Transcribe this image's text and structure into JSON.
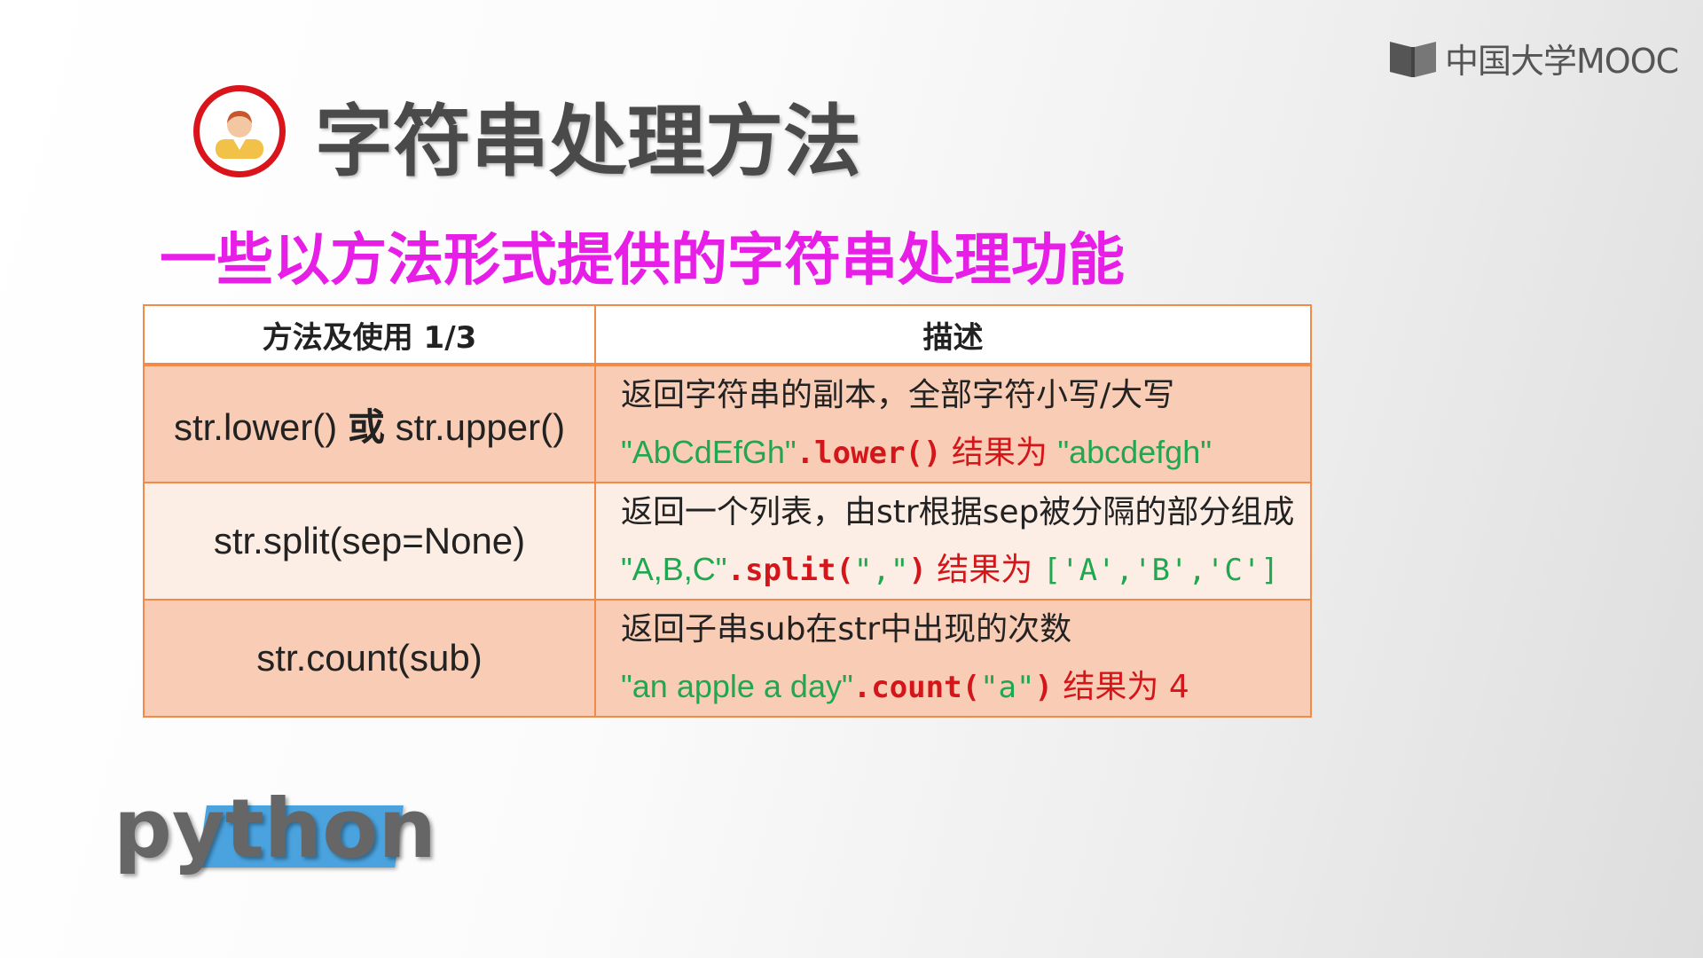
{
  "brand": {
    "logo_text": "中国大学MOOC",
    "icon": "mooc-book-icon"
  },
  "slide": {
    "title": "字符串处理方法",
    "subtitle": "一些以方法形式提供的字符串处理功能",
    "avatar_icon": "person-avatar-icon"
  },
  "colors": {
    "accent_red": "#d9141b",
    "subtitle_magenta": "#e61ee6",
    "table_border": "#f28a4a",
    "code_green": "#1fa84f",
    "code_red": "#d4161b"
  },
  "table": {
    "headers": {
      "method": "方法及使用 1/3",
      "description": "描述"
    },
    "rows": [
      {
        "method_a": "str.lower()",
        "method_or": "或",
        "method_b": "str.upper()",
        "desc": "返回字符串的副本，全部字符小写/大写",
        "ex_input": "\"AbCdEfGh\"",
        "ex_call": ".lower()",
        "ex_result_label": " 结果为 ",
        "ex_output": "\"abcdefgh\""
      },
      {
        "method": "str.split(sep=None)",
        "desc": "返回一个列表，由str根据sep被分隔的部分组成",
        "ex_input": "\"A,B,C\"",
        "ex_call_open": ".split(",
        "ex_arg": "\",\"",
        "ex_call_close": ")",
        "ex_result_label": " 结果为 ",
        "ex_output": "['A','B','C']"
      },
      {
        "method": "str.count(sub)",
        "desc": "返回子串sub在str中出现的次数",
        "ex_input": "\"an apple a day\"",
        "ex_call_open": ".count(",
        "ex_arg": "\"a\"",
        "ex_call_close": ")",
        "ex_result_label": " 结果为 ",
        "ex_output": "4"
      }
    ]
  },
  "python_logo": {
    "text": "python"
  }
}
